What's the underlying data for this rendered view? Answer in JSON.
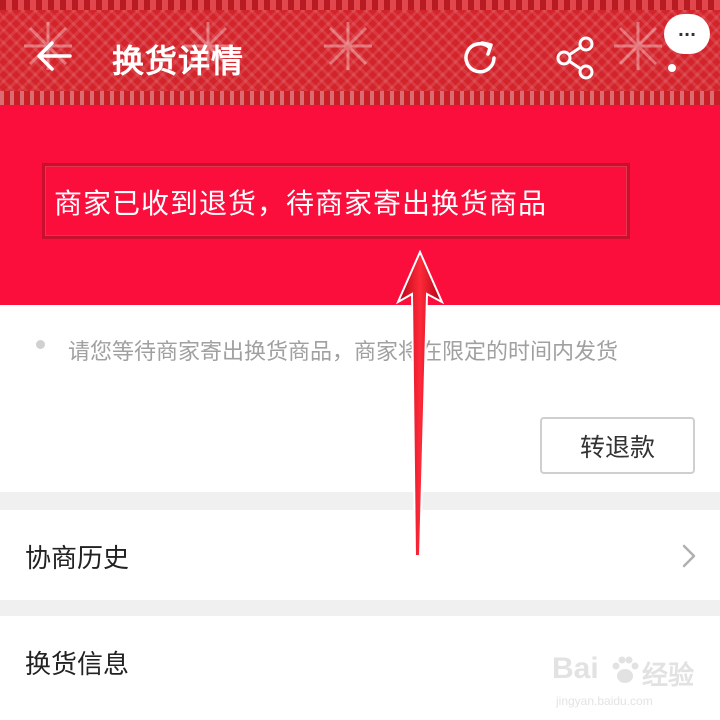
{
  "header": {
    "title": "换货详情",
    "back_icon": "arrow-left-icon",
    "refresh_icon": "refresh-icon",
    "share_icon": "share-icon",
    "more_label": "···"
  },
  "status": {
    "text": "商家已收到退货，待商家寄出换货商品"
  },
  "notice": {
    "text": "请您等待商家寄出换货商品，商家将在限定的时间内发货"
  },
  "actions": {
    "refund_label": "转退款"
  },
  "sections": [
    {
      "label": "协商历史",
      "icon": "chevron-right-icon"
    },
    {
      "label": "换货信息"
    }
  ],
  "watermark": {
    "main": "Bai",
    "main2": "经验",
    "sub": "jingyan.baidu.com"
  },
  "colors": {
    "header_red": "#d4242b",
    "banner_red": "#fb0d3c",
    "annotation_red": "#e0101e"
  }
}
